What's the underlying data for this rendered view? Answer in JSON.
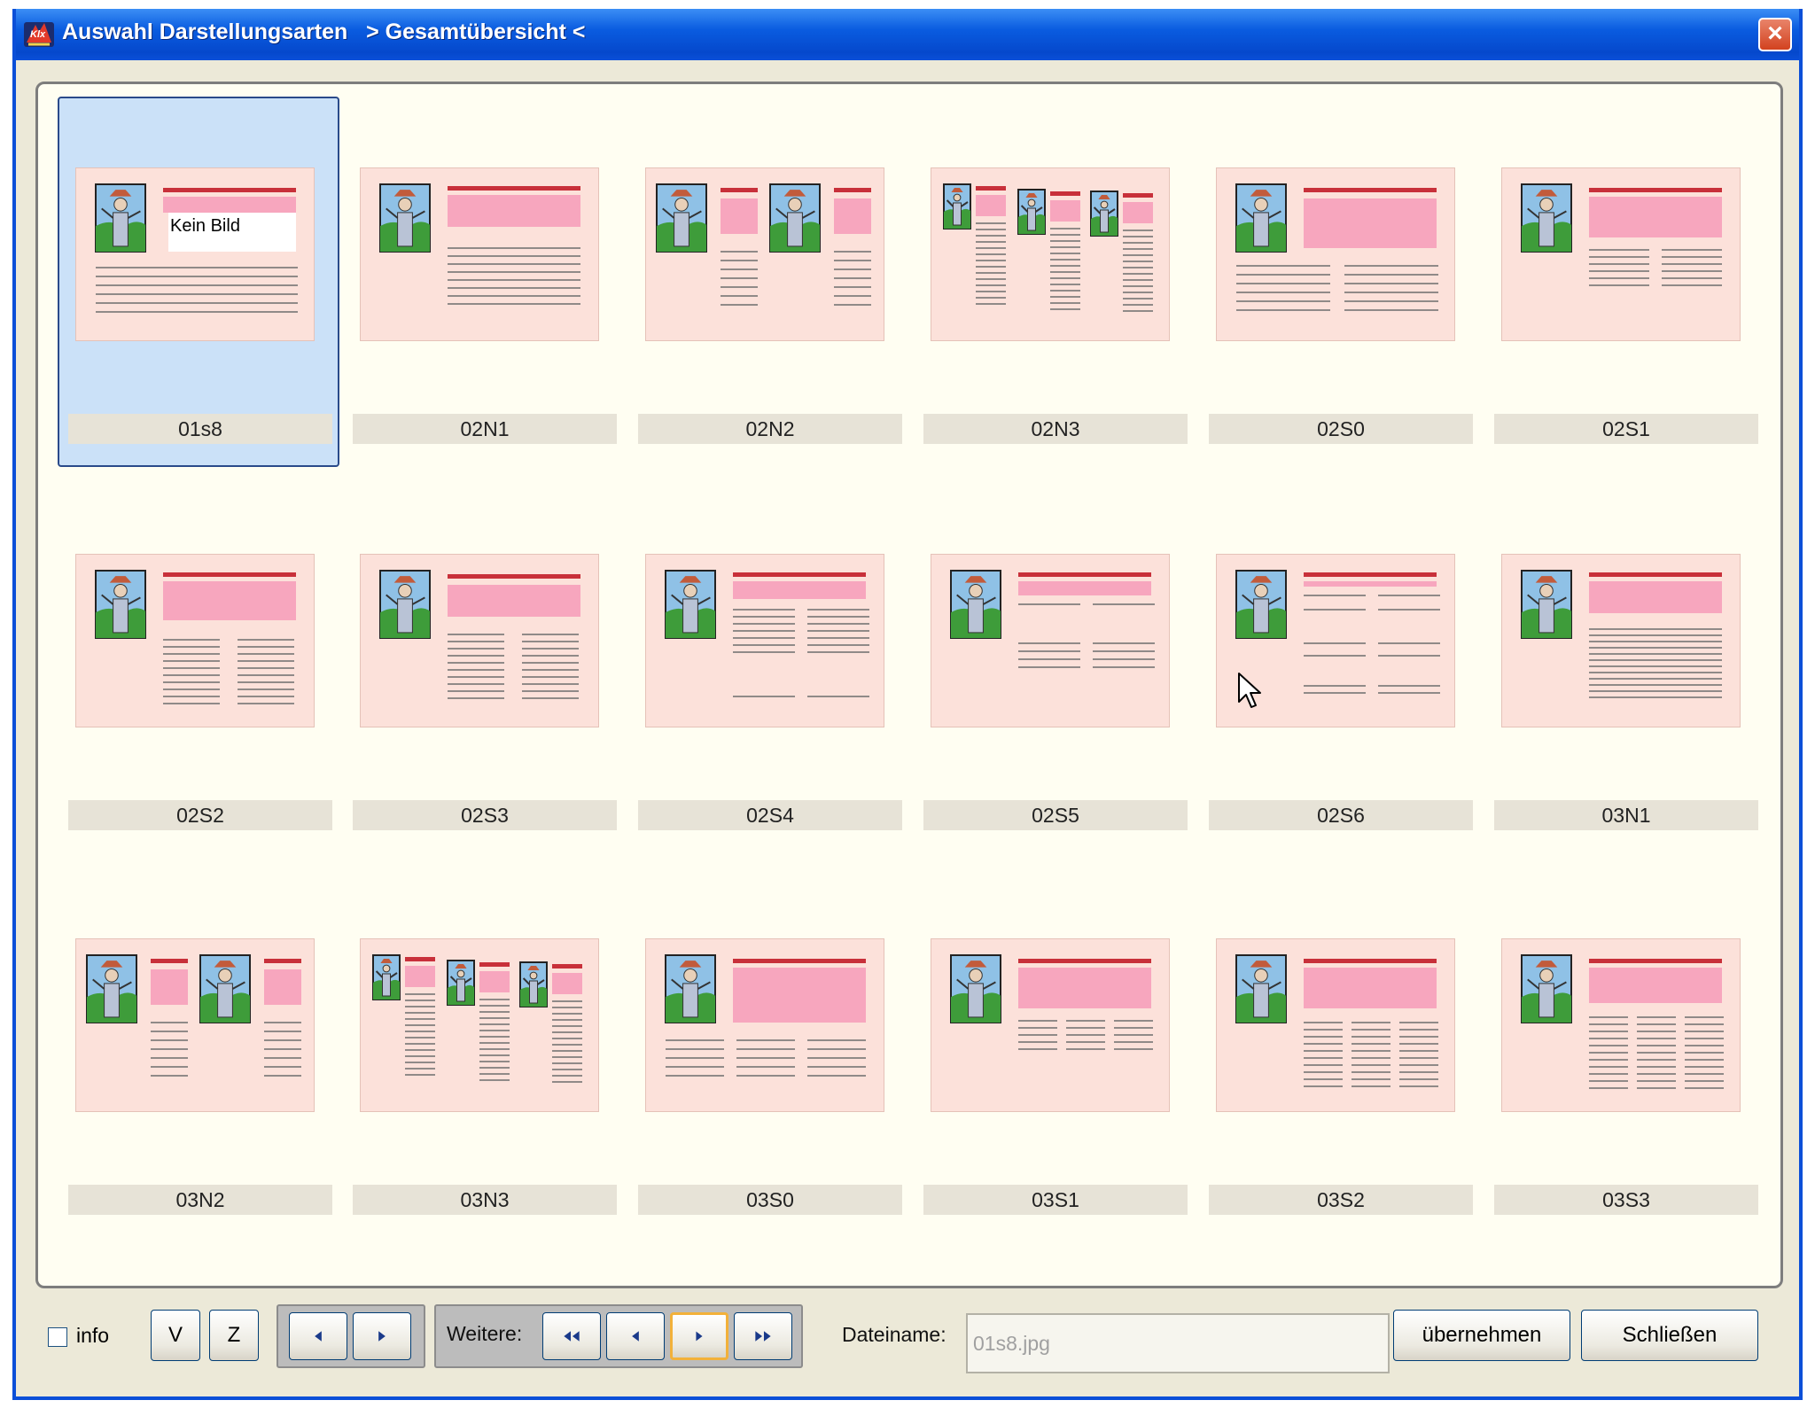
{
  "window": {
    "title": "Auswahl Darstellungsarten   > Gesamtübersicht <",
    "close_label": "×"
  },
  "grid": {
    "selected": "01s8",
    "items": [
      {
        "label": "01s8",
        "layout": "kein-bild",
        "overlay_text": "Kein Bild"
      },
      {
        "label": "02N1",
        "layout": "n1"
      },
      {
        "label": "02N2",
        "layout": "n2"
      },
      {
        "label": "02N3",
        "layout": "n3"
      },
      {
        "label": "02S0",
        "layout": "s0"
      },
      {
        "label": "02S1",
        "layout": "s1"
      },
      {
        "label": "02S2",
        "layout": "s2"
      },
      {
        "label": "02S3",
        "layout": "s3"
      },
      {
        "label": "02S4",
        "layout": "s4"
      },
      {
        "label": "02S5",
        "layout": "s5"
      },
      {
        "label": "02S6",
        "layout": "s6"
      },
      {
        "label": "03N1",
        "layout": "n1b"
      },
      {
        "label": "03N2",
        "layout": "n2"
      },
      {
        "label": "03N3",
        "layout": "n3"
      },
      {
        "label": "03S0",
        "layout": "s0b"
      },
      {
        "label": "03S1",
        "layout": "s1b"
      },
      {
        "label": "03S2",
        "layout": "s2b"
      },
      {
        "label": "03S3",
        "layout": "s3b"
      }
    ]
  },
  "bottom": {
    "info_label": "info",
    "info_checked": false,
    "v_label": "V",
    "z_label": "Z",
    "weitere_label": "Weitere:",
    "dateiname_label": "Dateiname:",
    "filename_value": "01s8.jpg",
    "apply_label": "übernehmen",
    "close_label": "Schließen"
  },
  "icons": {
    "app": "app-logo-icon",
    "prev": "arrow-left-icon",
    "next": "arrow-right-icon",
    "first": "double-arrow-left-icon",
    "last": "double-arrow-right-icon",
    "cursor": "mouse-pointer-icon"
  },
  "colors": {
    "titlebar": "#0a5ce0",
    "panel": "#fffef2",
    "selection": "#cbe1f8",
    "thumb_bg": "#fce1da",
    "thumb_header": "#c8303a",
    "thumb_block": "#f7a6be"
  }
}
